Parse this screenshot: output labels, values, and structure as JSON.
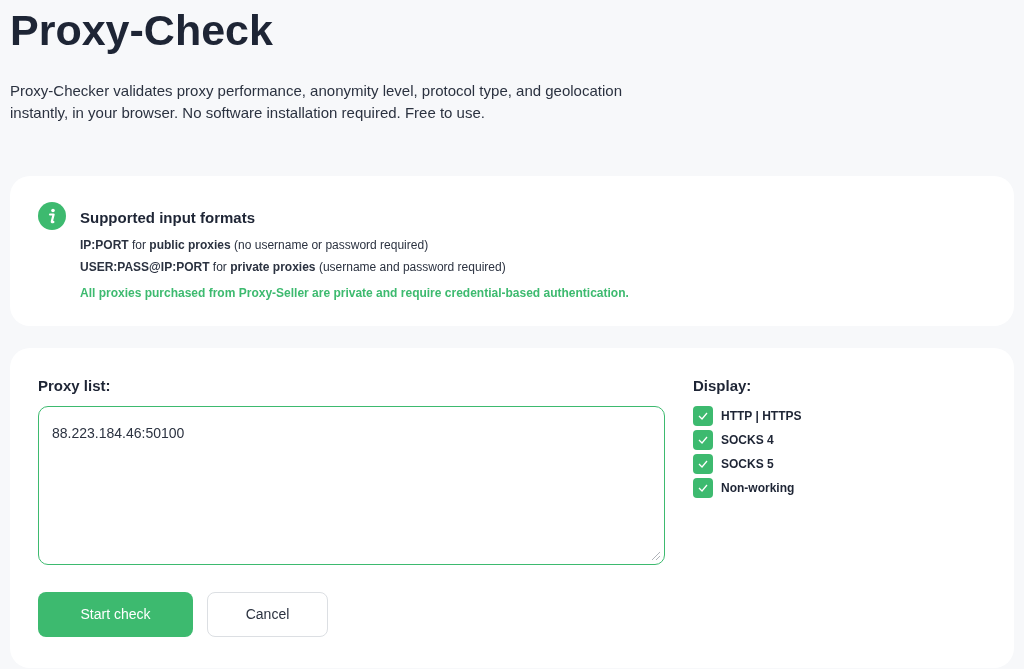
{
  "page": {
    "title": "Proxy-Check",
    "description": "Proxy-Checker validates proxy performance, anonymity level, protocol type, and geolocation instantly, in your browser. No software installation required. Free to use."
  },
  "info_card": {
    "title": "Supported input formats",
    "formats": [
      "**IP:PORT** for **public proxies** (no username or password required)",
      "**USER:PASS@IP:PORT** for **private proxies** (username and password required)"
    ],
    "note": "All proxies purchased from Proxy-Seller are private and require credential-based authentication."
  },
  "proxy_form": {
    "label": "Proxy list:",
    "value": "88.223.184.46:50100",
    "buttons": [
      {
        "label": "Start check",
        "kind": "primary"
      },
      {
        "label": "Cancel",
        "kind": "secondary"
      }
    ]
  },
  "display": {
    "label": "Display:",
    "options": [
      {
        "label": "HTTP | HTTPS",
        "checked": true
      },
      {
        "label": "SOCKS 4",
        "checked": true
      },
      {
        "label": "SOCKS 5",
        "checked": true
      },
      {
        "label": "Non-working",
        "checked": true
      }
    ]
  }
}
